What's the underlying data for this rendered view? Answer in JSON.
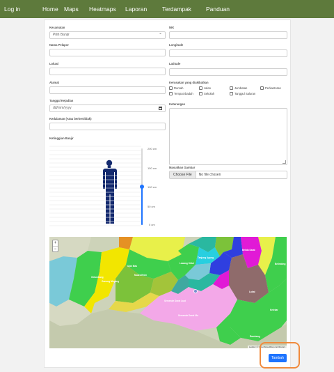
{
  "nav": {
    "items": [
      "Log in",
      "Home",
      "Maps",
      "Heatmaps",
      "Laporan",
      "Terdampak",
      "Panduan"
    ]
  },
  "form": {
    "kecamatan": {
      "label": "Kecamatan",
      "value": "Pilih Banjir"
    },
    "nama_pelapor": {
      "label": "Nama Pelapor"
    },
    "lokasi": {
      "label": "Lokasi"
    },
    "alamat": {
      "label": "Alamat"
    },
    "tanggal_kejadian": {
      "label": "Tanggal Kejadian",
      "placeholder": "dd/mm/yyyy"
    },
    "kedalaman": {
      "label": "Kedalaman (Atau berkerdidak)"
    },
    "ketinggian": {
      "label": "Ketinggian Banjir"
    },
    "nik": {
      "label": "NIK"
    },
    "longitude": {
      "label": "Longitude"
    },
    "latitude": {
      "label": "Latitude"
    },
    "kerusakan": {
      "label": "Kerusakan yang diakibatkan",
      "options": [
        "Rumah",
        "Jalan",
        "Jembatan",
        "Perkantoran",
        "Tempat Ibadah",
        "Sekolah",
        "Tanggul Saluran"
      ]
    },
    "keterangan": {
      "label": "Keterangan"
    },
    "gambar": {
      "label": "Masukkan Gambar",
      "button": "Choose File",
      "status": "No file chosen"
    },
    "submit_label": "Tambah"
  },
  "height_scale": {
    "labels": [
      "200 cm",
      "150 cm",
      "100 cm",
      "50 cm",
      "0 cm"
    ],
    "min_cm": 0,
    "max_cm": 200,
    "value_cm": 100
  },
  "map": {
    "attribution": "Leaflet | © OpenStreetMap contributors",
    "zoom_in": "+",
    "zoom_out": "−",
    "region_labels": [
      "Gelumbang",
      "Gunung Megang",
      "Ujan Mas",
      "Muara Enim",
      "Lawang Kidul",
      "Tanjung Agung",
      "Semende Darat Laut",
      "Semende Darat Ulu",
      "Lubai",
      "Rambang",
      "Kelekar",
      "Belida Darat",
      "Belimbing"
    ],
    "colors": {
      "yellow": "#f2e600",
      "olive": "#a3c43a",
      "green": "#3fcf4d",
      "blue": "#2f3fe0",
      "magenta": "#e11ad6",
      "pink": "#f3a8e8",
      "teal": "#2ab8a0",
      "orange": "#e59124",
      "cyan": "#28cfe0",
      "brown": "#8f6b6b"
    }
  },
  "colors": {
    "nav_bg": "#5e7a3c",
    "accent": "#1e74ff",
    "highlight": "#f08a3c"
  }
}
